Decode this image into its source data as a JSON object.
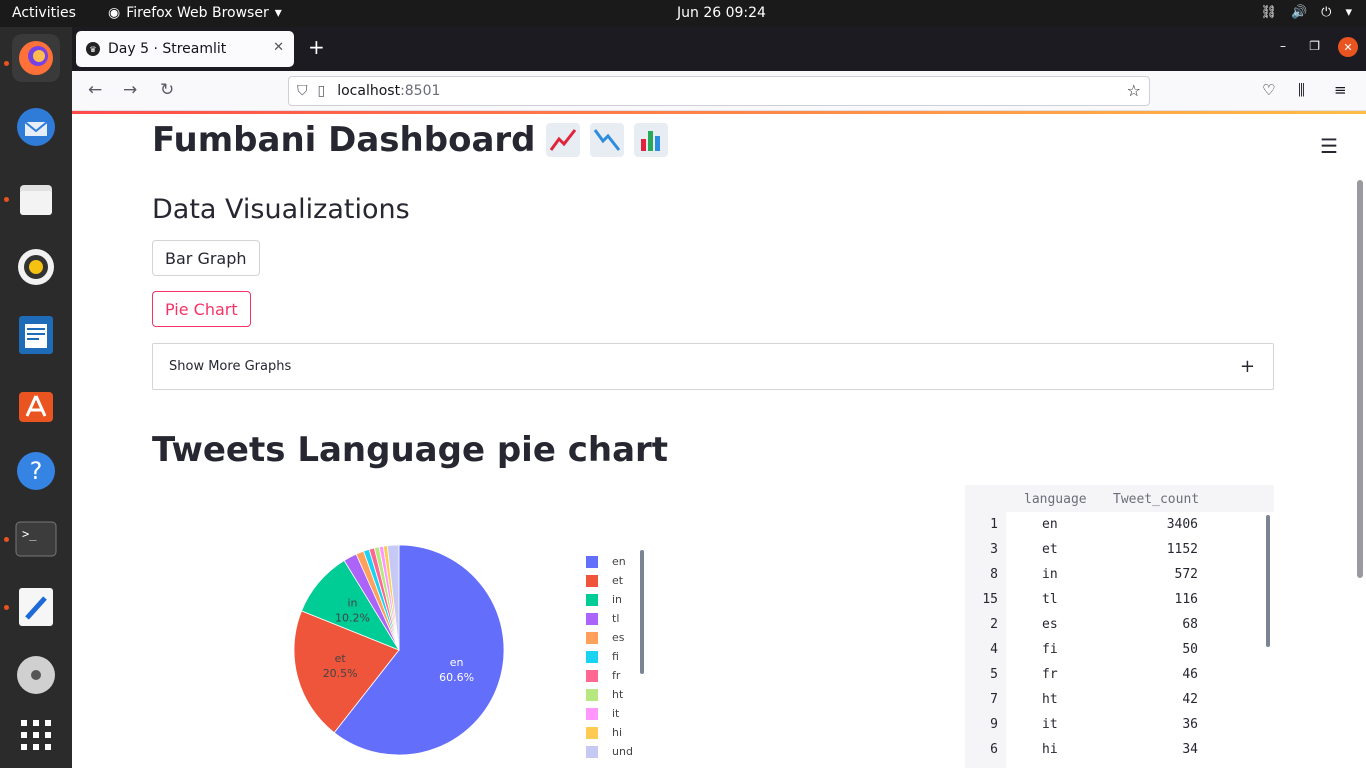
{
  "topbar": {
    "activities": "Activities",
    "app_name": "Firefox Web Browser",
    "clock": "Jun 26  09:24"
  },
  "browser": {
    "tab_title": "Day 5 · Streamlit",
    "url_host": "localhost",
    "url_port": ":8501"
  },
  "page": {
    "title": "Fumbani Dashboard",
    "subtitle": "Data Visualizations",
    "buttons": {
      "bar_graph": "Bar Graph",
      "pie_chart": "Pie Chart"
    },
    "expander_label": "Show More Graphs",
    "expander_icon": "+",
    "section_title": "Tweets Language pie chart"
  },
  "colors": {
    "accent": "#f63366",
    "en": "#636efa",
    "et": "#ef553b",
    "in": "#00cc96",
    "tl": "#ab63fa",
    "es": "#ffa15a",
    "fi": "#19d3f3",
    "fr": "#ff6692",
    "ht": "#b6e880",
    "it": "#ff97ff",
    "hi": "#fecb52",
    "und": "#c7c9f5"
  },
  "chart_data": {
    "type": "pie",
    "labels": [
      "en",
      "et",
      "in",
      "tl",
      "es",
      "fi",
      "fr",
      "ht",
      "it",
      "hi",
      "und"
    ],
    "values": [
      3406,
      1152,
      572,
      116,
      68,
      50,
      46,
      42,
      36,
      34,
      100
    ],
    "slice_text": [
      {
        "label": "en",
        "percent": "60.6%"
      },
      {
        "label": "et",
        "percent": "20.5%"
      },
      {
        "label": "in",
        "percent": "10.2%"
      }
    ],
    "legend": [
      "en",
      "et",
      "in",
      "tl",
      "es",
      "fi",
      "fr",
      "ht",
      "it",
      "hi",
      "und"
    ],
    "legend_placement": "right"
  },
  "dataframe": {
    "columns": [
      "language",
      "Tweet_count"
    ],
    "rows": [
      {
        "index": "1",
        "language": "en",
        "count": "3406"
      },
      {
        "index": "3",
        "language": "et",
        "count": "1152"
      },
      {
        "index": "8",
        "language": "in",
        "count": "572"
      },
      {
        "index": "15",
        "language": "tl",
        "count": "116"
      },
      {
        "index": "2",
        "language": "es",
        "count": "68"
      },
      {
        "index": "4",
        "language": "fi",
        "count": "50"
      },
      {
        "index": "5",
        "language": "fr",
        "count": "46"
      },
      {
        "index": "7",
        "language": "ht",
        "count": "42"
      },
      {
        "index": "9",
        "language": "it",
        "count": "36"
      },
      {
        "index": "6",
        "language": "hi",
        "count": "34"
      }
    ]
  }
}
